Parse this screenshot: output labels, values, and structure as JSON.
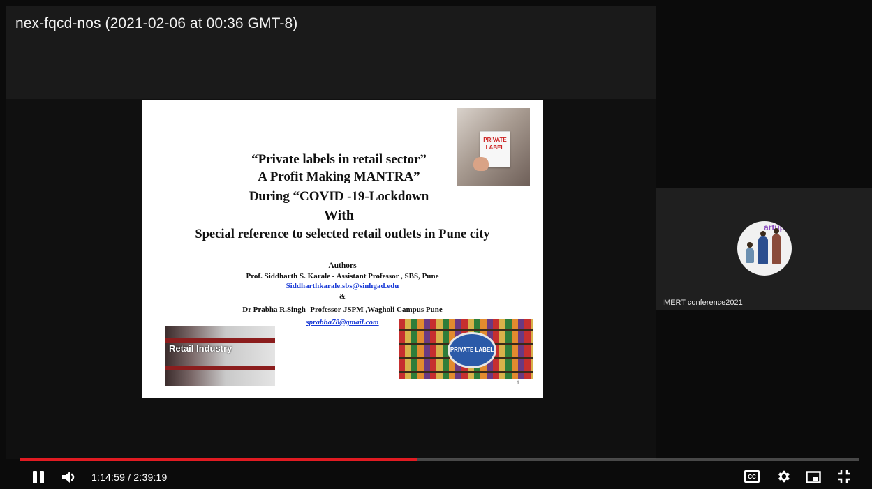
{
  "player": {
    "title": "nex-fqcd-nos (2021-02-06 at 00:36 GMT-8)",
    "time_current": "1:14:59",
    "time_total": "2:39:19",
    "time_separator": "/",
    "progress_fraction": 0.473,
    "accent_color": "#e11b22"
  },
  "slide": {
    "title_line1": "“Private labels in retail sector”",
    "title_line2": "A Profit Making MANTRA”",
    "title_line3": "During “COVID -19-Lockdown",
    "title_line4": "With",
    "title_line5": "Special reference to selected retail outlets in Pune city",
    "authors_heading": "Authors",
    "author1": "Prof. Siddharth S. Karale  - Assistant Professor , SBS, Pune",
    "author1_email": "Siddharthkarale.sbs@sinhgad.edu",
    "ampersand": "&",
    "author2": "Dr Prabha R.Singh- Professor-JSPM ,Wagholi Campus Pune",
    "author2_email": "sprabha78@gmail.com",
    "page_number": "1",
    "private_label_card": "PRIVATE LABEL",
    "retail_caption": "Retail Industry",
    "badge_text": "PRIVATE LABEL"
  },
  "participant": {
    "name": "IMERT conference2021",
    "avatar_text": "artup"
  },
  "icons": {
    "pause": "pause-icon",
    "volume": "volume-icon",
    "captions": "captions-icon",
    "settings": "gear-icon",
    "miniplayer": "miniplayer-icon",
    "exit_fullscreen": "exit-fullscreen-icon",
    "cc_text": "CC"
  }
}
